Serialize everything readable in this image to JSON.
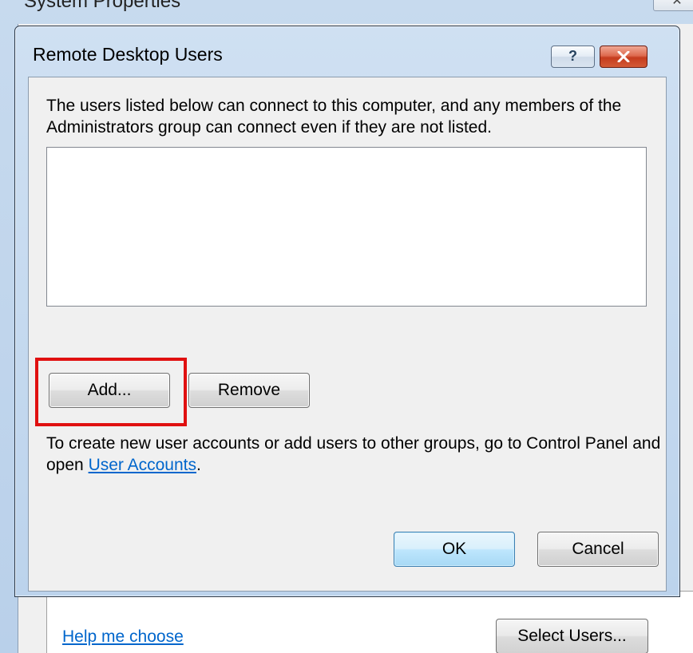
{
  "background_window": {
    "title": "System Properties",
    "close_glyph": "✕",
    "help_link": "Help me choose",
    "select_users_label": "Select Users..."
  },
  "dialog": {
    "title": "Remote Desktop Users",
    "help_glyph": "?",
    "close_icon": "close-icon",
    "description": "The users listed below can connect to this computer, and any members of the Administrators group can connect even if they are not listed.",
    "users": [],
    "add_label": "Add...",
    "remove_label": "Remove",
    "info_text": "To create new user accounts or add users to other groups, go to Control Panel and open ",
    "info_link": "User Accounts",
    "info_suffix": ".",
    "ok_label": "OK",
    "cancel_label": "Cancel",
    "highlight_color": "#e01010",
    "link_color": "#0066cc"
  }
}
